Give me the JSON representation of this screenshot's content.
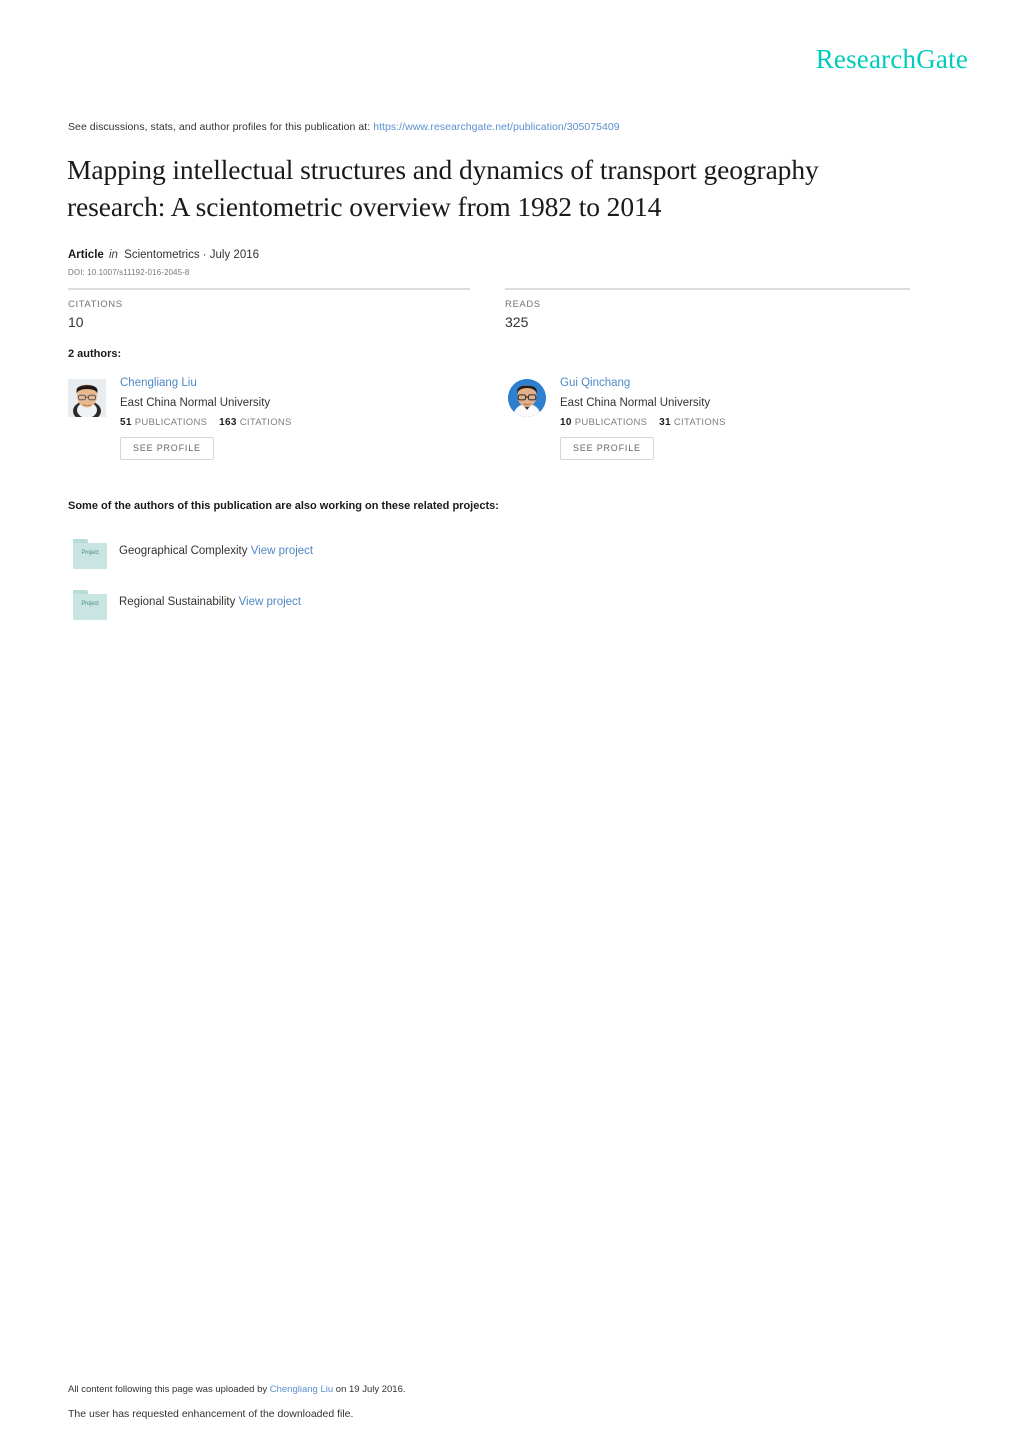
{
  "brand": {
    "name": "ResearchGate",
    "color": "#00ccbb"
  },
  "discussion": {
    "prefix": "See discussions, stats, and author profiles for this publication at:",
    "url": "https://www.researchgate.net/publication/305075409"
  },
  "publication": {
    "title": "Mapping intellectual structures and dynamics of transport geography research: A scientometric overview from 1982 to 2014",
    "type": "Article",
    "in_word": "in",
    "journal": "Scientometrics · July 2016",
    "doi": "DOI: 10.1007/s11192-016-2045-8"
  },
  "stats": {
    "citations_label": "CITATIONS",
    "citations_value": "10",
    "reads_label": "READS",
    "reads_value": "325"
  },
  "authors_section": {
    "heading": "2 authors:",
    "see_profile_label": "SEE PROFILE",
    "publications_label": "PUBLICATIONS",
    "citations_label": "CITATIONS",
    "authors": [
      {
        "name": "Chengliang Liu",
        "affiliation": "East China Normal University",
        "publications": "51",
        "citations": "163",
        "avatar_style": "square-photo"
      },
      {
        "name": "Gui Qinchang",
        "affiliation": "East China Normal University",
        "publications": "10",
        "citations": "31",
        "avatar_style": "circle-blue-photo"
      }
    ]
  },
  "projects_section": {
    "heading": "Some of the authors of this publication are also working on these related projects:",
    "folder_icon_label": "Project",
    "view_label": "View project",
    "projects": [
      {
        "name": "Geographical Complexity"
      },
      {
        "name": "Regional Sustainability"
      }
    ]
  },
  "footer": {
    "line1_prefix": "All content following this page was uploaded by",
    "uploader": "Chengliang Liu",
    "line1_suffix": "on 19 July 2016.",
    "line2": "The user has requested enhancement of the downloaded file."
  }
}
